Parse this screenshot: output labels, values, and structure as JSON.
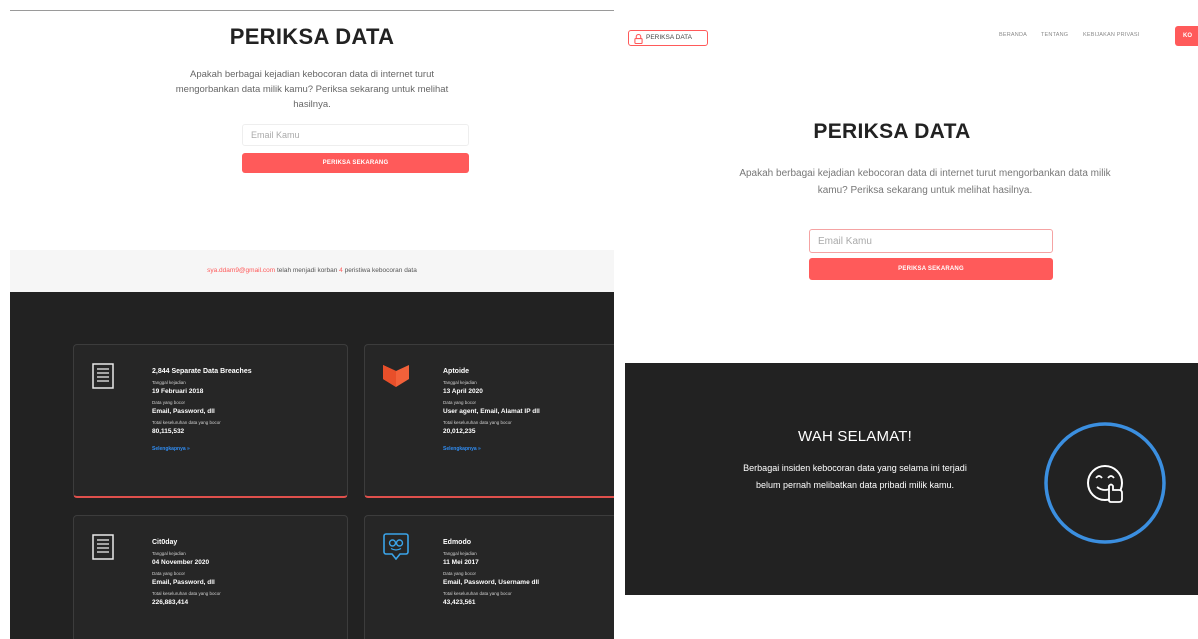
{
  "left": {
    "title": "PERIKSA DATA",
    "description": "Apakah berbagai kejadian kebocoran data di internet turut mengorbankan data milik kamu? Periksa sekarang untuk melihat hasilnya.",
    "email_placeholder": "Email Kamu",
    "check_button": "PERIKSA SEKARANG",
    "victim": {
      "email": "sya.ddam9@gmail.com",
      "text_mid": "telah menjadi korban",
      "count": "4",
      "text_end": "peristiwa kebocoran data"
    },
    "breaches": [
      {
        "name": "2,844 Separate Data Breaches",
        "icon": "document-icon",
        "date_label": "Tanggal kejadian",
        "date": "19 Februari 2018",
        "data_label": "Data yang bocor",
        "data": "Email, Password, dll",
        "total_label": "Total keseluruhan data yang bocor",
        "total": "80,115,532",
        "more": "Selengkapnya »"
      },
      {
        "name": "Aptoide",
        "icon": "aptoide-logo-icon",
        "date_label": "Tanggal kejadian",
        "date": "13 April 2020",
        "data_label": "Data yang bocor",
        "data": "User agent, Email, Alamat IP dll",
        "total_label": "Total keseluruhan data yang bocor",
        "total": "20,012,235",
        "more": "Selengkapnya »"
      },
      {
        "name": "Cit0day",
        "icon": "document-icon",
        "date_label": "Tanggal kejadian",
        "date": "04 November 2020",
        "data_label": "Data yang bocor",
        "data": "Email, Password, dll",
        "total_label": "Total keseluruhan data yang bocor",
        "total": "226,883,414"
      },
      {
        "name": "Edmodo",
        "icon": "edmodo-logo-icon",
        "date_label": "Tanggal kejadian",
        "date": "11 Mei 2017",
        "data_label": "Data yang bocor",
        "data": "Email, Password, Username dll",
        "total_label": "Total keseluruhan data yang bocor",
        "total": "43,423,561"
      }
    ]
  },
  "right": {
    "logo_text": "PERIKSA DATA",
    "nav": [
      "BERANDA",
      "TENTANG",
      "KEBIJAKAN PRIVASI"
    ],
    "nav_button": "KO",
    "title": "PERIKSA DATA",
    "description": "Apakah berbagai kejadian kebocoran data di internet turut mengorbankan data milik kamu? Periksa sekarang untuk melihat hasilnya.",
    "email_placeholder": "Email Kamu",
    "check_button": "PERIKSA SEKARANG",
    "result_title": "WAH SELAMAT!",
    "result_text": "Berbagai insiden kebocoran data yang selama ini terjadi belum pernah melibatkan data pribadi milik kamu."
  },
  "colors": {
    "accent": "#ff5a5a",
    "dark_bg": "#222222",
    "link_blue": "#2f8cf2",
    "ring_blue": "#3b8fe0"
  }
}
